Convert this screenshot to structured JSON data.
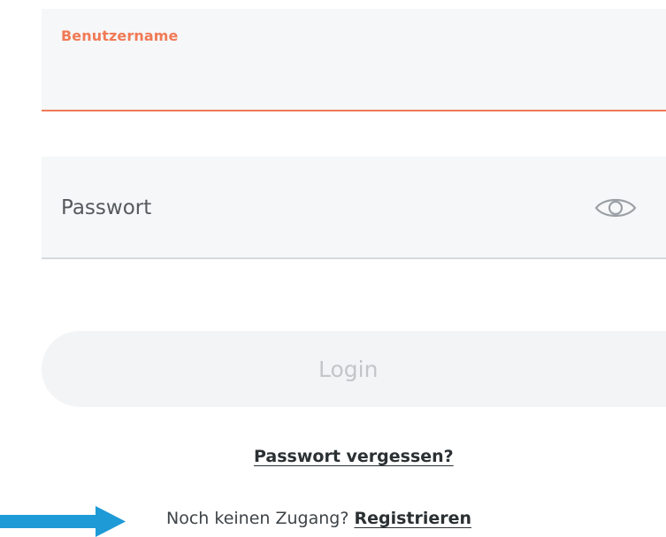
{
  "username": {
    "label": "Benutzername",
    "value": ""
  },
  "password": {
    "placeholder": "Passwort",
    "value": "",
    "toggle_icon": "eye-icon"
  },
  "login": {
    "label": "Login"
  },
  "links": {
    "forgot": "Passwort vergessen?",
    "no_account": "Noch keinen Zugang? ",
    "register": "Registrieren"
  },
  "colors": {
    "accent": "#f07a56",
    "arrow": "#1e9ad6",
    "field_bg": "#f6f7f8",
    "button_bg": "#f3f4f5",
    "button_text": "#c3c6c9"
  },
  "icons": {
    "arrow": "arrow-right-icon"
  }
}
